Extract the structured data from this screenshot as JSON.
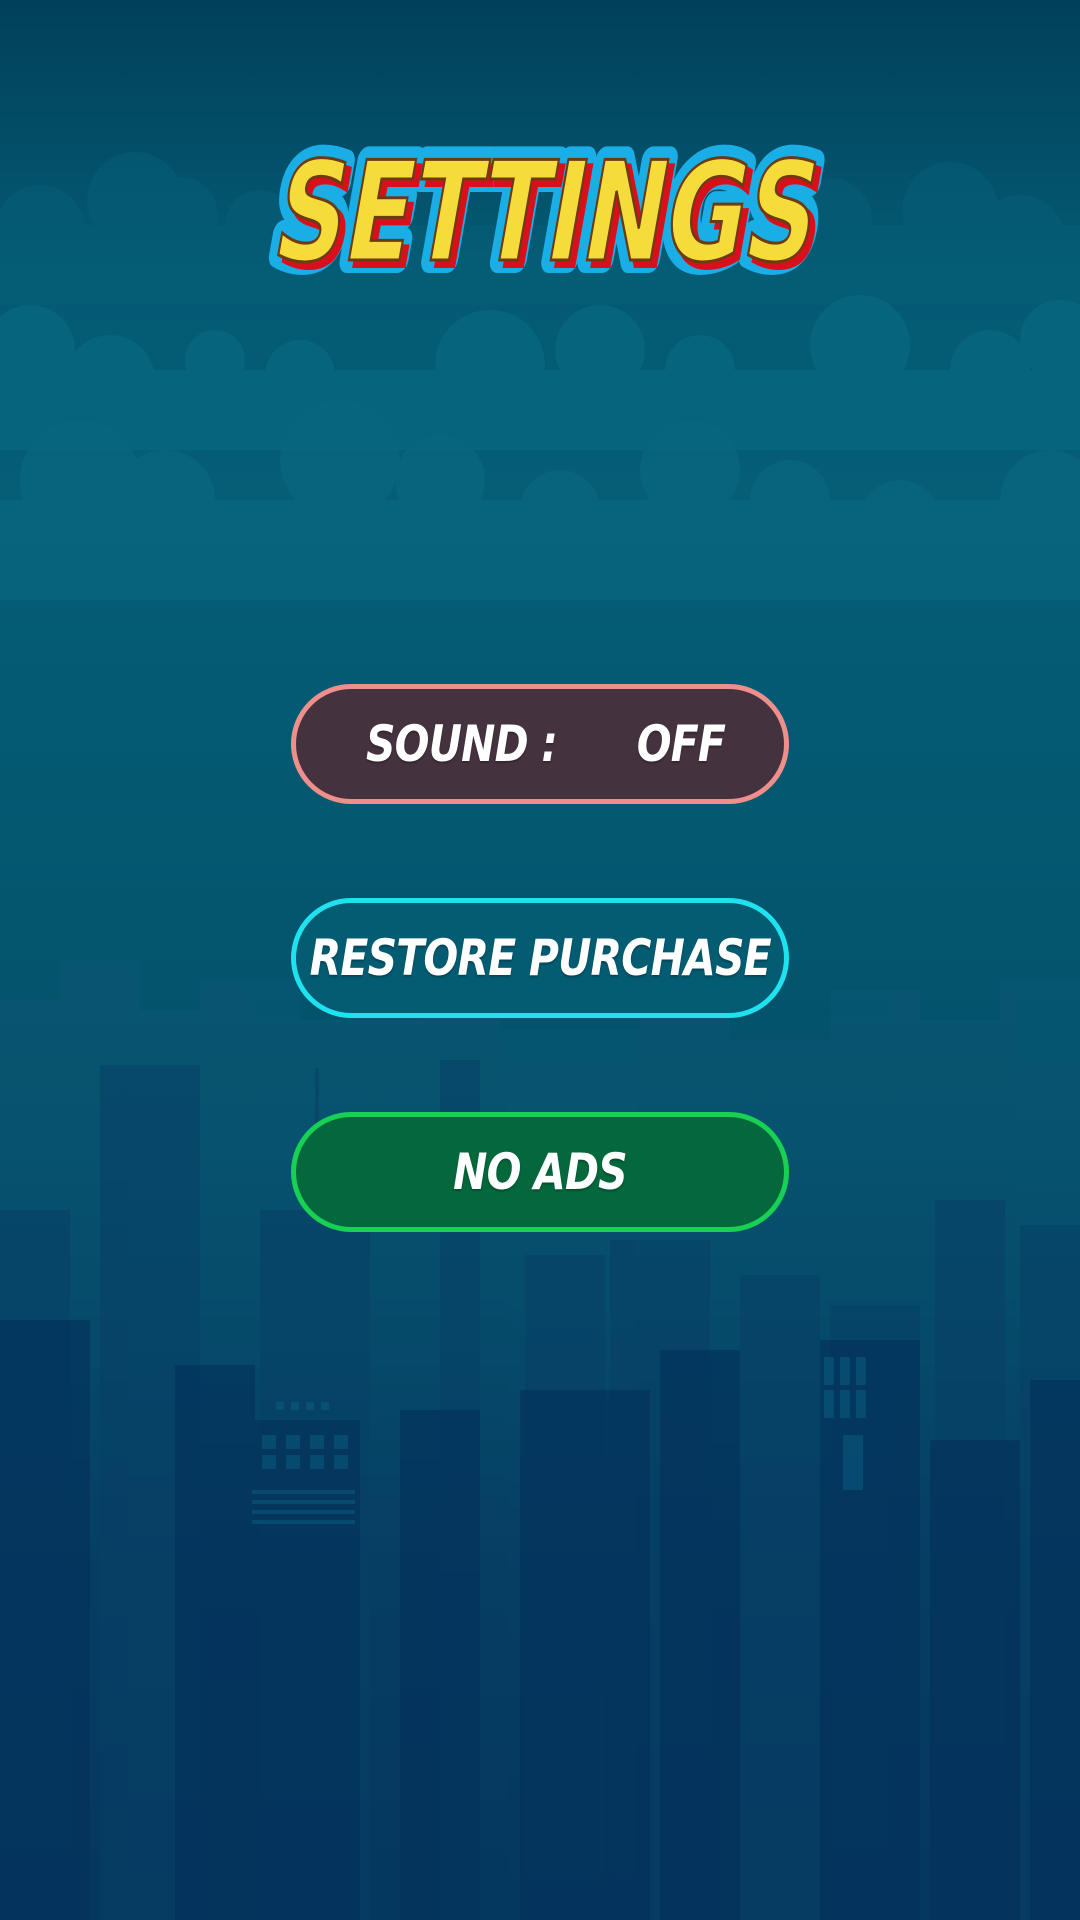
{
  "title": "SETTINGS",
  "buttons": {
    "sound_label": "SOUND :",
    "sound_value": "OFF",
    "restore_label": "RESTORE PURCHASE",
    "noads_label": "NO ADS"
  },
  "colors": {
    "title_fill": "#f5dc3a",
    "title_shadow": "#d8101c",
    "title_outline": "#1aaee6",
    "sound_border": "#ef8f8c",
    "sound_fill": "#45323f",
    "restore_border": "#1ee3ee",
    "restore_fill": "#045c72",
    "noads_border": "#18d154",
    "noads_fill": "#04683c"
  }
}
